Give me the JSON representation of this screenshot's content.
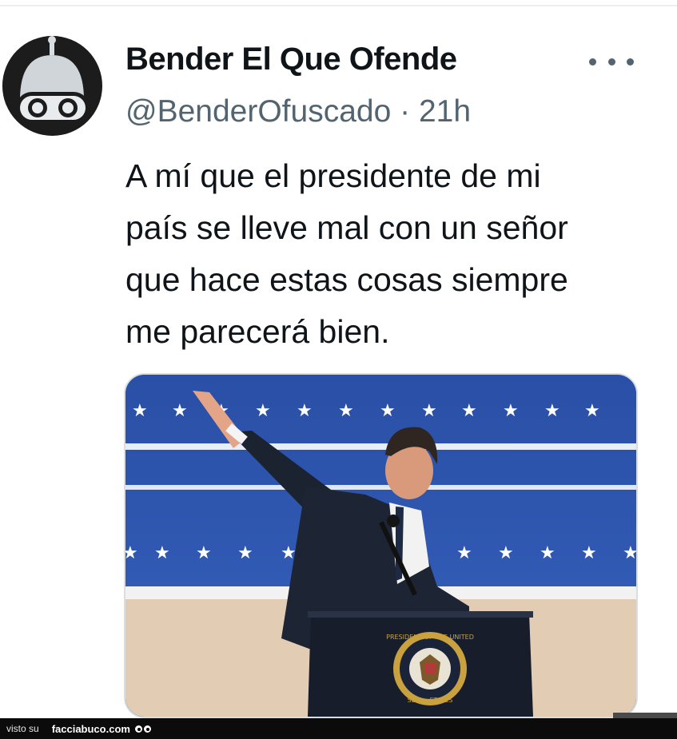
{
  "tweet": {
    "display_name": "Bender El Que Ofende",
    "handle": "@BenderOfuscado",
    "separator": "·",
    "time": "21h",
    "text_lines": [
      "A mí que el presidente de mi",
      "país se lleve mal con un señor",
      "que hace estas cosas siempre",
      "me parecerá bien."
    ],
    "avatar_icon": "bender-robot-avatar",
    "more_icon": "more-dots-icon"
  },
  "media": {
    "seal_text_top": "PRESIDENT OF THE UNITED",
    "seal_text_bottom": "SEAL · STATES"
  },
  "footer": {
    "visto_label": "visto su",
    "site_label": "facciabuco.com",
    "logo_icon": "facciabuco-eyes-icon"
  },
  "colors": {
    "text_primary": "#0f1419",
    "text_secondary": "#536471",
    "stage_blue": "#2f55ad",
    "footer_bg": "#0b0b0b"
  }
}
